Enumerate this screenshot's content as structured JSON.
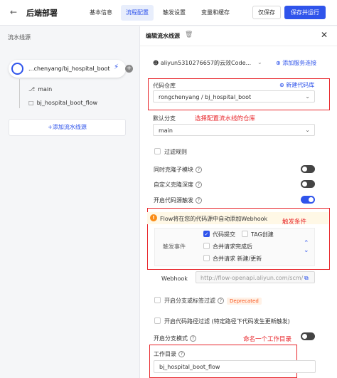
{
  "header": {
    "back_icon": "arrow-left-icon",
    "title": "后端部署",
    "tabs": [
      "基本信息",
      "流程配置",
      "触发设置",
      "变量和缓存"
    ],
    "active_tab": "流程配置",
    "save_label": "仅保存",
    "run_label": "保存并运行"
  },
  "left": {
    "title": "流水线源",
    "source_name": "...chenyang/bj_hospital_boot",
    "branch": "main",
    "folder": "bj_hospital_boot_flow",
    "add_label": "+添加流水线源"
  },
  "right": {
    "title": "编辑流水线源",
    "account": "aliyun5310276657的云效Code...",
    "add_service_link": "添加服务连接",
    "repo_label": "代码仓库",
    "new_repo_link": "新建代码库",
    "repo_value": "rongchenyang / bj_hospital_boot",
    "annotation_repo": "选择配置流水线的仓库",
    "branch_label": "默认分支",
    "branch_value": "main",
    "filter_rule": "过滤规则",
    "clone_submodule": "同时克隆子模块",
    "custom_clone_depth": "自定义克隆深度",
    "enable_trigger": "开启代码源触发",
    "warn_text": "Flow将在您的代码源中自动添加Webhook",
    "annotation_trigger": "触发条件",
    "trigger_event_label": "触发事件",
    "events": {
      "code_commit": "代码提交",
      "tag_create": "TAG创建",
      "merge_done": "合并请求完成后",
      "merge_new": "合并请求 新建/更新"
    },
    "webhook_label": "Webhook",
    "webhook_url": "http://flow-openapi.aliyun.com/scm/",
    "branch_mode_filter": "开启分支或标签过滤",
    "deprecated_badge": "Deprecated",
    "path_filter": "开启代码路径过滤 (特定路径下代码发生更新触发)",
    "branch_mode": "开启分支模式",
    "annotation_workdir": "命名一个工作目录",
    "workdir_label": "工作目录",
    "workdir_value": "bj_hospital_boot_flow"
  },
  "colors": {
    "accent": "#2f54eb",
    "annotation_red": "#e8262b"
  }
}
